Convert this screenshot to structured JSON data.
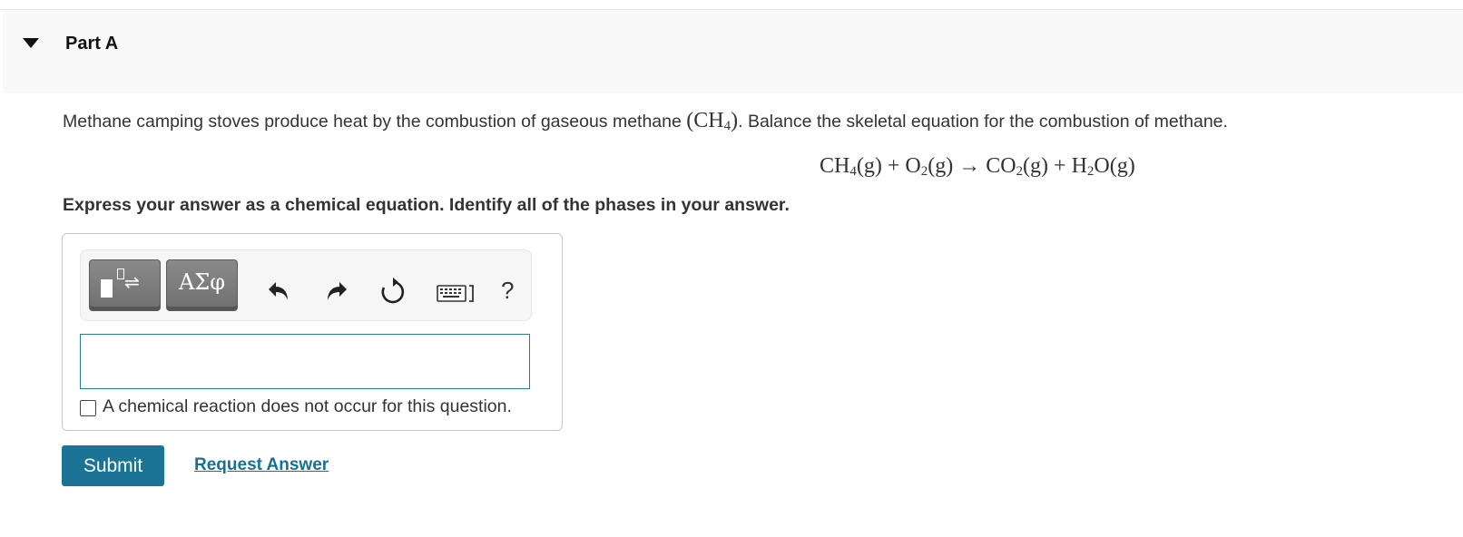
{
  "part": {
    "title": "Part A",
    "caret_icon": "caret-down-icon"
  },
  "question": {
    "text_before": "Methane camping stoves produce heat by the combustion of gaseous methane",
    "formula_open": "(CH",
    "formula_sub": "4",
    "formula_close": ")",
    "text_after": ". Balance the skeletal equation for the combustion of methane."
  },
  "equation": {
    "r1": "CH",
    "r1_sub": "4",
    "r1_phase": "(g)",
    "plus1": "+",
    "r2": "O",
    "r2_sub": "2",
    "r2_phase": "(g)",
    "arrow": "→",
    "p1": "CO",
    "p1_sub": "2",
    "p1_phase": "(g)",
    "plus2": "+",
    "p2": "H",
    "p2_sub": "2",
    "p2_rest": "O(g)"
  },
  "instruction": "Express your answer as a chemical equation. Identify all of the phases in your answer.",
  "toolbar": {
    "templates_icon": "templates-icon",
    "symbols_label": "ΑΣφ",
    "undo_icon": "undo-icon",
    "redo_icon": "redo-icon",
    "reset_icon": "reset-icon",
    "keyboard_icon": "keyboard-icon",
    "help_label": "?"
  },
  "answer_input": {
    "value": ""
  },
  "no_reaction": {
    "label": "A chemical reaction does not occur for this question.",
    "checked": false
  },
  "actions": {
    "submit_label": "Submit",
    "request_label": "Request Answer"
  },
  "colors": {
    "accent": "#1b7493",
    "link": "#1b6f91",
    "input_border": "#2a7a95",
    "toolbar_button": "#7a7a7a"
  }
}
